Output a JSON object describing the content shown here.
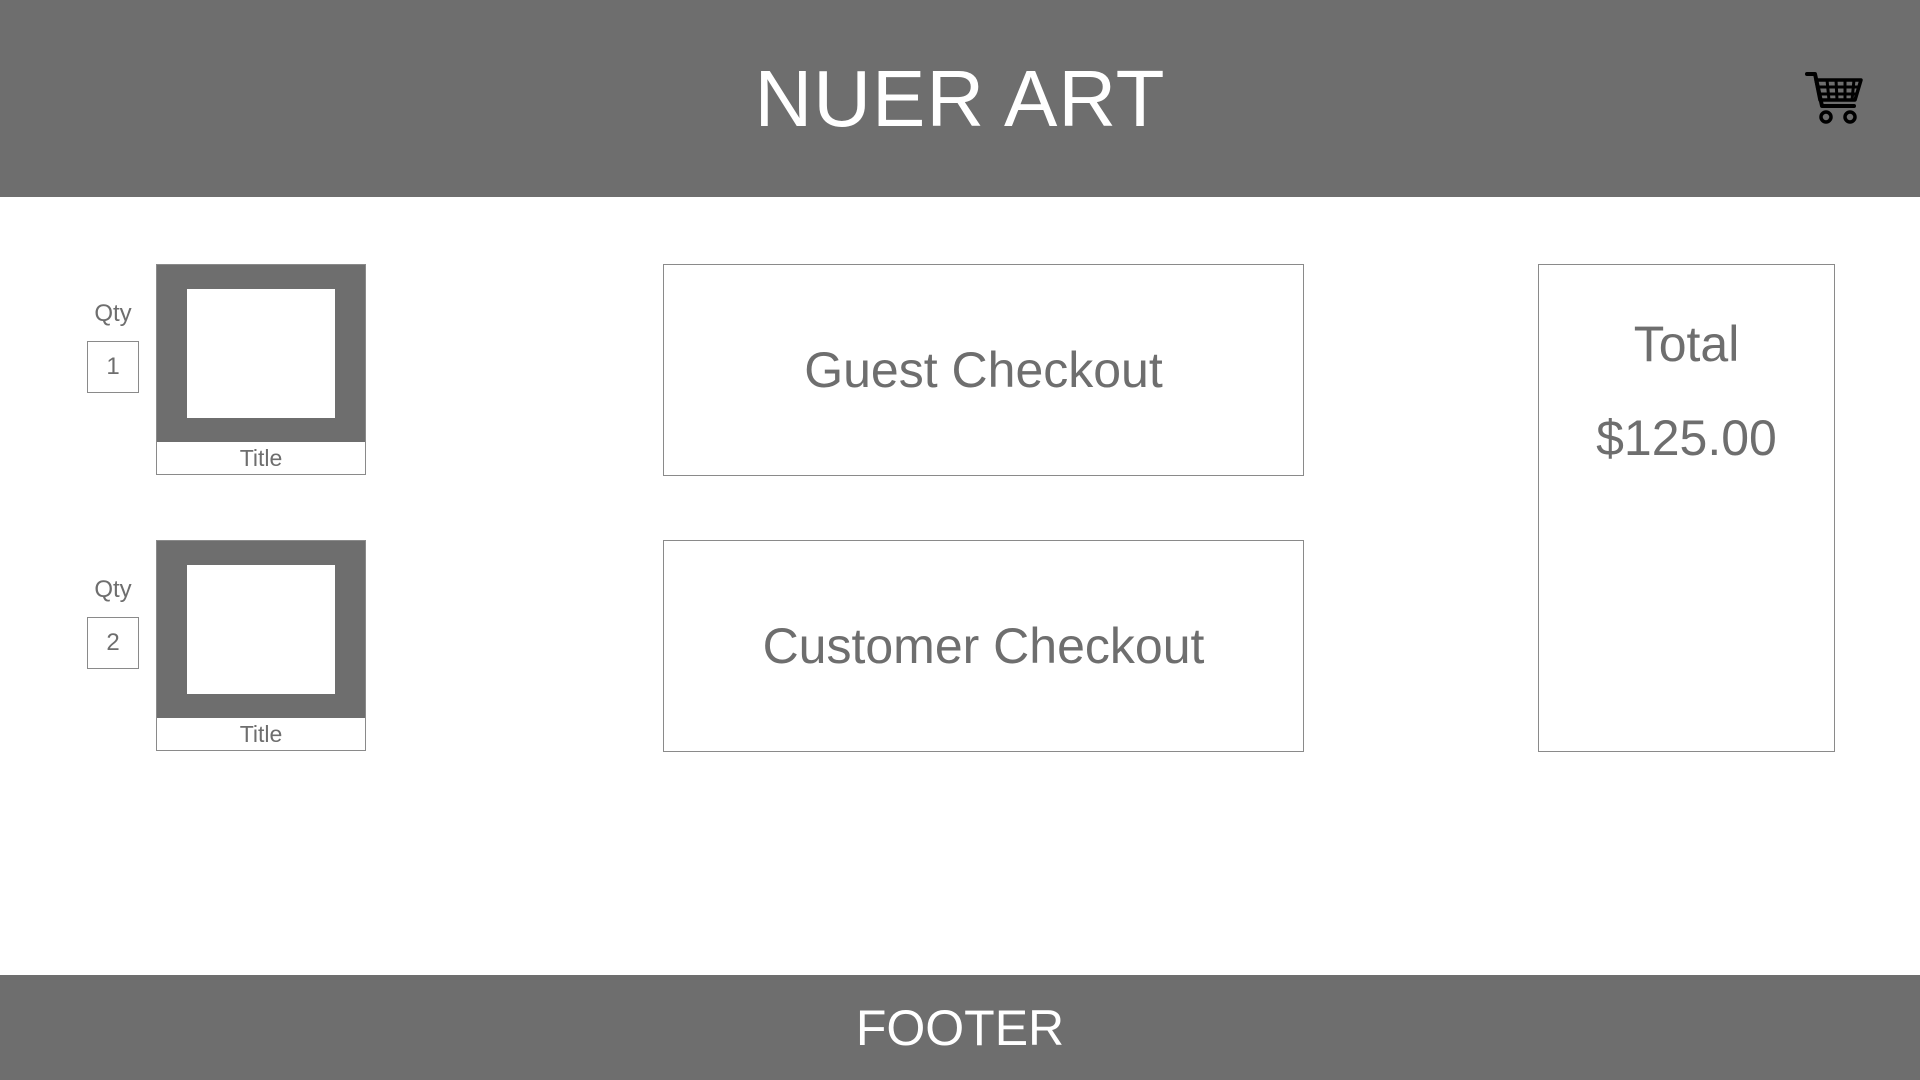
{
  "header": {
    "brand": "NUER ART",
    "cart_icon": "shopping-cart-icon"
  },
  "cart_items": [
    {
      "qty_label": "Qty",
      "qty_value": "1",
      "title": "Title"
    },
    {
      "qty_label": "Qty",
      "qty_value": "2",
      "title": "Title"
    }
  ],
  "checkout": {
    "guest_label": "Guest Checkout",
    "customer_label": "Customer Checkout"
  },
  "summary": {
    "total_label": "Total",
    "total_value": "$125.00"
  },
  "footer": {
    "label": "FOOTER"
  },
  "colors": {
    "bar": "#6e6e6e",
    "background": "#ffffff",
    "text": "#6e6e6e",
    "border": "#8a8a8a"
  }
}
